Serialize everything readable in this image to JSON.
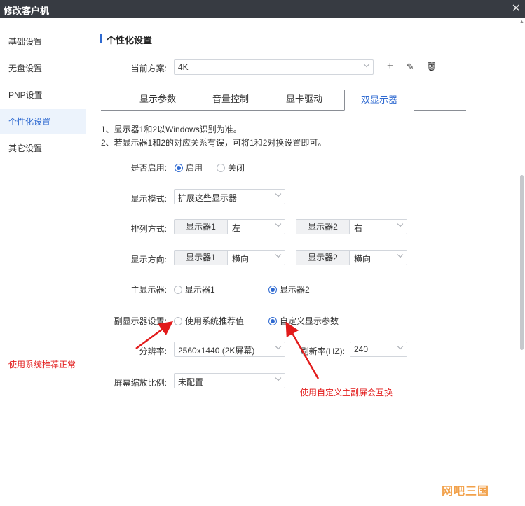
{
  "window": {
    "title": "修改客户机",
    "close_glyph": "✕"
  },
  "sidebar": {
    "items": [
      {
        "label": "基础设置"
      },
      {
        "label": "无盘设置"
      },
      {
        "label": "PNP设置"
      },
      {
        "label": "个性化设置"
      },
      {
        "label": "其它设置"
      }
    ],
    "active_index": 3,
    "note": "使用系统推荐正常"
  },
  "section": {
    "title": "个性化设置"
  },
  "scheme": {
    "label": "当前方案:",
    "value": "4K",
    "add_icon": "+",
    "edit_icon": "✎",
    "delete_icon": "🗑"
  },
  "tabs": [
    {
      "label": "显示参数"
    },
    {
      "label": "音量控制"
    },
    {
      "label": "显卡驱动"
    },
    {
      "label": "双显示器"
    }
  ],
  "active_tab_index": 3,
  "notes": [
    "1、显示器1和2以Windows识别为准。",
    "2、若显示器1和2的对应关系有误，可将1和2对换设置即可。"
  ],
  "form": {
    "enable": {
      "label": "是否启用:",
      "on": "启用",
      "off": "关闭",
      "selected": "on"
    },
    "display_mode": {
      "label": "显示模式:",
      "value": "扩展这些显示器"
    },
    "arrangement": {
      "label": "排列方式:",
      "monitor1_tag": "显示器1",
      "monitor1_value": "左",
      "monitor2_tag": "显示器2",
      "monitor2_value": "右"
    },
    "orientation": {
      "label": "显示方向:",
      "monitor1_tag": "显示器1",
      "monitor1_value": "横向",
      "monitor2_tag": "显示器2",
      "monitor2_value": "横向"
    },
    "primary": {
      "label": "主显示器:",
      "option1": "显示器1",
      "option2": "显示器2",
      "selected": "option2"
    },
    "secondary": {
      "label": "副显示器设置:",
      "option1": "使用系统推荐值",
      "option2": "自定义显示参数",
      "selected": "option2"
    },
    "resolution": {
      "label": "分辨率:",
      "value": "2560x1440 (2K屏幕)"
    },
    "refresh": {
      "label": "刷新率(HZ):",
      "value": "240"
    },
    "scaling": {
      "label": "屏幕缩放比例:",
      "value": "未配置"
    }
  },
  "annotations": {
    "custom_note": "使用自定义主副屏会互换"
  },
  "watermark": "网吧三国",
  "colors": {
    "accent": "#2f6ad1",
    "annotation": "#e21b1b",
    "titlebar": "#373b42"
  }
}
